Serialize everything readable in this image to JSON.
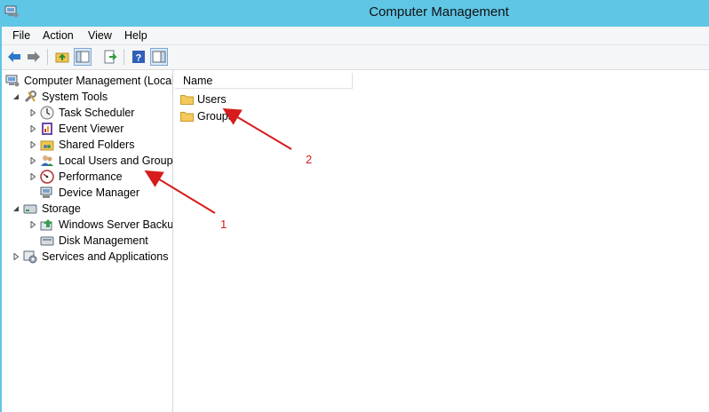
{
  "window": {
    "title": "Computer Management"
  },
  "menu": {
    "items": [
      "File",
      "Action",
      "View",
      "Help"
    ]
  },
  "toolbar": {
    "buttons": [
      "back-icon",
      "forward-icon",
      "up-folder-icon",
      "show-hide-console-tree-icon",
      "export-list-icon",
      "help-icon",
      "show-hide-action-pane-icon"
    ]
  },
  "tree": {
    "root": "Computer Management (Local",
    "system_tools": "System Tools",
    "task_scheduler": "Task Scheduler",
    "event_viewer": "Event Viewer",
    "shared_folders": "Shared Folders",
    "local_users_groups": "Local Users and Groups",
    "performance": "Performance",
    "device_manager": "Device Manager",
    "storage": "Storage",
    "windows_server_backup": "Windows Server Backup",
    "disk_management": "Disk Management",
    "services_apps": "Services and Applications"
  },
  "list": {
    "column_name": "Name",
    "items": [
      "Users",
      "Groups"
    ]
  },
  "annotations": {
    "label1": "1",
    "label2": "2",
    "color": "#d61c1c"
  },
  "colors": {
    "titlebar": "#5fc6e6",
    "folder": "#f5c95a"
  }
}
